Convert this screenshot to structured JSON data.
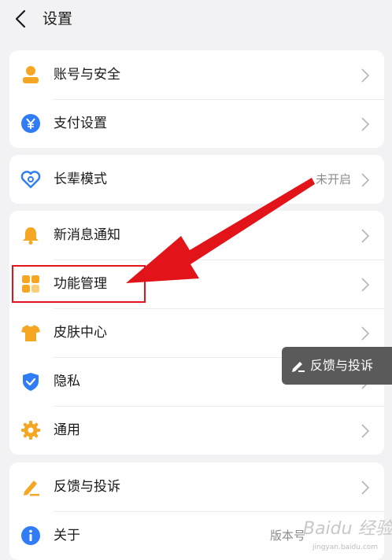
{
  "header": {
    "title": "设置"
  },
  "groups": [
    {
      "items": [
        {
          "label": "账号与安全",
          "icon": "user-icon"
        },
        {
          "label": "支付设置",
          "icon": "yuan-icon"
        }
      ]
    },
    {
      "items": [
        {
          "label": "长辈模式",
          "icon": "heart-icon",
          "value": "未开启"
        }
      ]
    },
    {
      "items": [
        {
          "label": "新消息通知",
          "icon": "bell-icon"
        },
        {
          "label": "功能管理",
          "icon": "apps-icon"
        },
        {
          "label": "皮肤中心",
          "icon": "shirt-icon"
        },
        {
          "label": "隐私",
          "icon": "shield-icon"
        },
        {
          "label": "通用",
          "icon": "gear-icon"
        }
      ]
    },
    {
      "items": [
        {
          "label": "反馈与投诉",
          "icon": "pen-icon"
        },
        {
          "label": "关于",
          "icon": "info-icon",
          "value": "版本号"
        }
      ]
    }
  ],
  "floating_button": {
    "label": "反馈与投诉",
    "icon": "pen-icon"
  },
  "watermark": {
    "logo": "Baidu 经验",
    "url": "jingyan.baidu.com"
  },
  "colors": {
    "accent_orange": "#f5a623",
    "accent_blue": "#2f7cf6",
    "annotation_red": "#e2141a"
  }
}
